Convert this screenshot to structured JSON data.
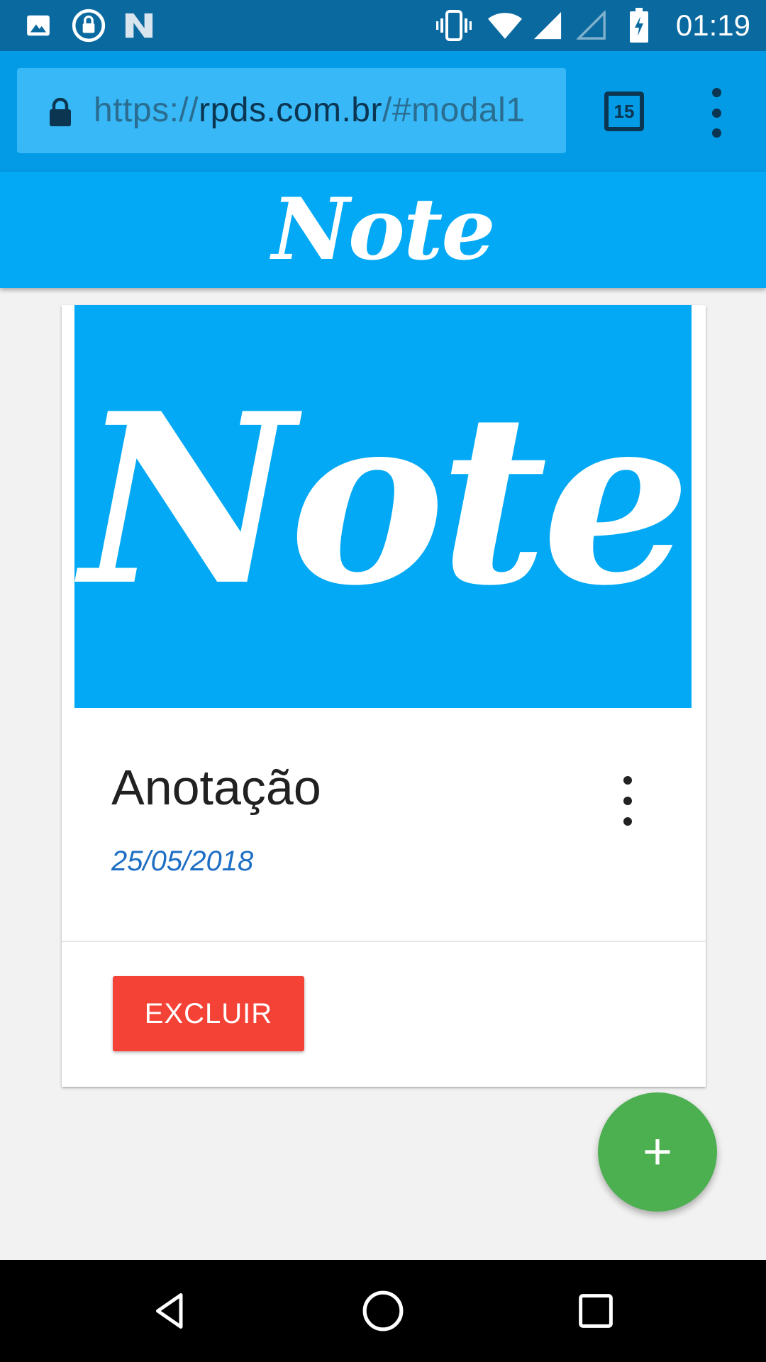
{
  "status_bar": {
    "time": "01:19",
    "icons": [
      "image-icon",
      "lock-rotation-icon",
      "n-icon",
      "vibrate-icon",
      "wifi-icon",
      "signal-icon",
      "signal-empty-icon",
      "battery-charging-icon"
    ]
  },
  "browser": {
    "url_scheme": "https://",
    "url_host": "rpds.com.br",
    "url_fragment": "/#modal1",
    "tab_count": "15"
  },
  "app": {
    "logo_text": "Note"
  },
  "card": {
    "image_logo_text": "Note",
    "title": "Anotação",
    "date": "25/05/2018",
    "delete_label": "EXCLUIR"
  },
  "fab": {
    "label": "+"
  },
  "colors": {
    "status_bar": "#0a6aa0",
    "url_bar": "#039be5",
    "brand": "#03a9f4",
    "delete": "#f44336",
    "fab": "#4caf50",
    "date": "#1e6fc4"
  }
}
